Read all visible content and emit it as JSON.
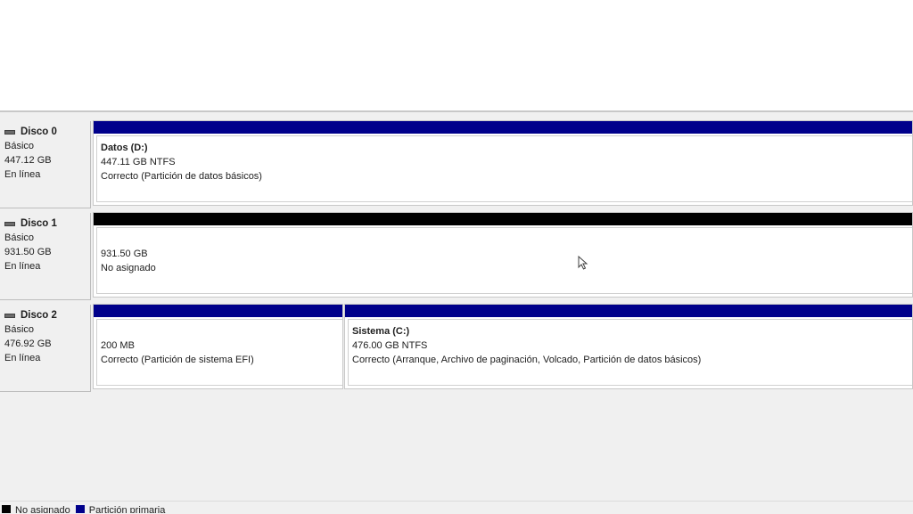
{
  "disks": [
    {
      "name": "Disco 0",
      "type": "Básico",
      "size": "447.12 GB",
      "status": "En línea",
      "partitions": [
        {
          "kind": "primary",
          "label": "Datos  (D:)",
          "size_fs": "447.11 GB NTFS",
          "status": "Correcto (Partición de datos básicos)"
        }
      ]
    },
    {
      "name": "Disco 1",
      "type": "Básico",
      "size": "931.50 GB",
      "status": "En línea",
      "partitions": [
        {
          "kind": "unallocated",
          "label": "",
          "size_fs": "931.50 GB",
          "status": "No asignado"
        }
      ]
    },
    {
      "name": "Disco 2",
      "type": "Básico",
      "size": "476.92 GB",
      "status": "En línea",
      "partitions": [
        {
          "kind": "primary",
          "label": "",
          "size_fs": "200 MB",
          "status": "Correcto (Partición de sistema EFI)"
        },
        {
          "kind": "primary",
          "label": "Sistema  (C:)",
          "size_fs": "476.00 GB NTFS",
          "status": "Correcto (Arranque, Archivo de paginación, Volcado, Partición de datos básicos)"
        }
      ]
    }
  ],
  "legend": {
    "unallocated": "No asignado",
    "primary": "Partición primaria"
  },
  "colors": {
    "primary_bar": "#00008b",
    "unallocated_bar": "#000000"
  },
  "icons": {
    "disk": "disk-drive-icon",
    "cursor": "mouse-pointer-icon"
  }
}
